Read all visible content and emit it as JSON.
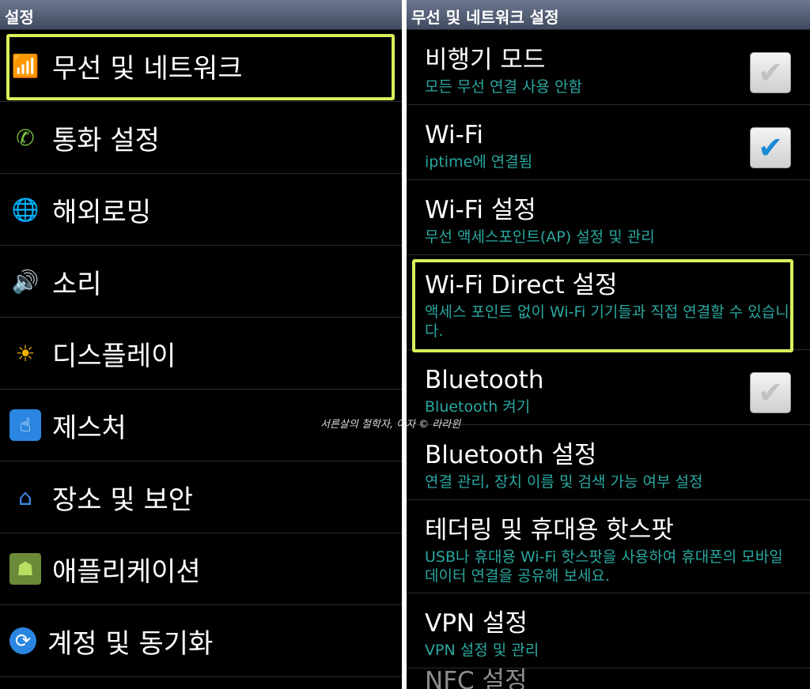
{
  "left": {
    "title": "설정",
    "items": [
      {
        "label": "무선 및 네트워크",
        "icon": "wifi-icon"
      },
      {
        "label": "통화 설정",
        "icon": "phone-icon"
      },
      {
        "label": "해외로밍",
        "icon": "globe-icon"
      },
      {
        "label": "소리",
        "icon": "speaker-icon"
      },
      {
        "label": "디스플레이",
        "icon": "brightness-icon"
      },
      {
        "label": "제스처",
        "icon": "gesture-icon"
      },
      {
        "label": "장소 및 보안",
        "icon": "lock-home-icon"
      },
      {
        "label": "애플리케이션",
        "icon": "android-icon"
      },
      {
        "label": "계정 및 동기화",
        "icon": "sync-icon"
      }
    ]
  },
  "right": {
    "title": "무선 및 네트워크 설정",
    "items": [
      {
        "title": "비행기 모드",
        "subtitle": "모든 무선 연결 사용 안함",
        "checked": false
      },
      {
        "title": "Wi-Fi",
        "subtitle": "iptime에 연결됨",
        "checked": true
      },
      {
        "title": "Wi-Fi 설정",
        "subtitle": "무선 액세스포인트(AP) 설정 및 관리"
      },
      {
        "title": "Wi-Fi Direct 설정",
        "subtitle": "액세스 포인트 없이 Wi-Fi 기기들과 직접 연결할 수 있습니다."
      },
      {
        "title": "Bluetooth",
        "subtitle": "Bluetooth 켜기",
        "checked": false
      },
      {
        "title": "Bluetooth 설정",
        "subtitle": "연결 관리, 장치 이름 및 검색 가능 여부 설정"
      },
      {
        "title": "테더링 및 휴대용 핫스팟",
        "subtitle": "USB나 휴대용 Wi-Fi 핫스팟을 사용하여 휴대폰의 모바일 데이터 연결을 공유해 보세요."
      },
      {
        "title": "VPN 설정",
        "subtitle": "VPN 설정 및 관리"
      },
      {
        "title": "NFC 설정"
      }
    ]
  },
  "watermark": "서른살의 철학자, 여자 © 라라윈",
  "colors": {
    "highlight": "#d6f25a",
    "subtitle": "#2aa8a0",
    "checkbox_on": "#1a8ad6"
  }
}
